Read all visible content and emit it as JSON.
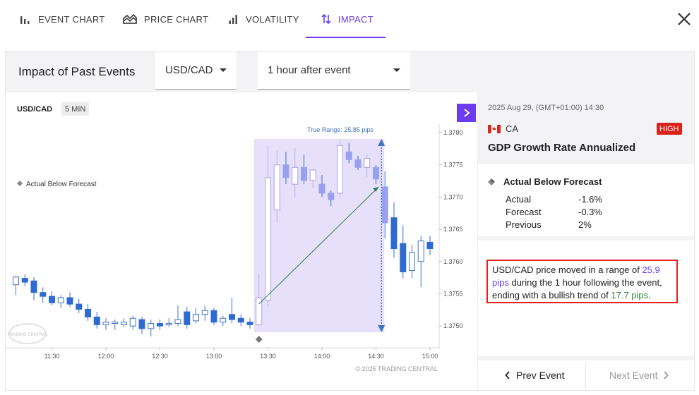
{
  "tabs": [
    {
      "label": "EVENT CHART",
      "icon": "bar-chart-icon"
    },
    {
      "label": "PRICE CHART",
      "icon": "price-chart-icon"
    },
    {
      "label": "VOLATILITY",
      "icon": "volatility-icon"
    },
    {
      "label": "IMPACT",
      "icon": "up-down-arrows-icon",
      "active": true
    }
  ],
  "panel": {
    "title": "Impact of Past Events",
    "pair_select": "USD/CAD",
    "window_select": "1 hour after event"
  },
  "chart": {
    "symbol": "USD/CAD",
    "timeframe": "5 MIN",
    "legend_marker": "Actual Below Forecast",
    "range_label": "True Range: 25.85 pips",
    "watermark": "TRADING CENTRAL",
    "copyright": "© 2025 TRADING CENTRAL"
  },
  "chart_data": {
    "type": "candlestick",
    "instrument": "USD/CAD",
    "interval": "5 MIN",
    "x_ticks": [
      "11:30",
      "12:00",
      "12:30",
      "13:00",
      "13:30",
      "14:00",
      "14:30",
      "15:00"
    ],
    "y_ticks": [
      1.378,
      1.3775,
      1.377,
      1.3765,
      1.376,
      1.3755,
      1.375
    ],
    "ylim": [
      1.3748,
      1.3782
    ],
    "event_time": "13:30",
    "window": [
      "13:30",
      "14:30"
    ],
    "candles": [
      {
        "t": 0,
        "o": 1.37564,
        "h": 1.37578,
        "l": 1.37548,
        "c": 1.37576
      },
      {
        "t": 1,
        "o": 1.37574,
        "h": 1.3758,
        "l": 1.37562,
        "c": 1.37568
      },
      {
        "t": 2,
        "o": 1.3757,
        "h": 1.37576,
        "l": 1.3754,
        "c": 1.37552
      },
      {
        "t": 3,
        "o": 1.37552,
        "h": 1.3756,
        "l": 1.37536,
        "c": 1.37546
      },
      {
        "t": 4,
        "o": 1.37546,
        "h": 1.37554,
        "l": 1.37532,
        "c": 1.37536
      },
      {
        "t": 5,
        "o": 1.37536,
        "h": 1.37548,
        "l": 1.37528,
        "c": 1.37544
      },
      {
        "t": 6,
        "o": 1.37544,
        "h": 1.37552,
        "l": 1.3753,
        "c": 1.37534
      },
      {
        "t": 7,
        "o": 1.37534,
        "h": 1.37542,
        "l": 1.3752,
        "c": 1.37526
      },
      {
        "t": 8,
        "o": 1.37526,
        "h": 1.37534,
        "l": 1.37508,
        "c": 1.37514
      },
      {
        "t": 9,
        "o": 1.37514,
        "h": 1.37522,
        "l": 1.37496,
        "c": 1.37502
      },
      {
        "t": 10,
        "o": 1.37502,
        "h": 1.37512,
        "l": 1.37494,
        "c": 1.37506
      },
      {
        "t": 11,
        "o": 1.37504,
        "h": 1.3751,
        "l": 1.37494,
        "c": 1.37506
      },
      {
        "t": 12,
        "o": 1.37502,
        "h": 1.37512,
        "l": 1.37498,
        "c": 1.37506
      },
      {
        "t": 13,
        "o": 1.375,
        "h": 1.37516,
        "l": 1.37494,
        "c": 1.37512
      },
      {
        "t": 14,
        "o": 1.3751,
        "h": 1.37514,
        "l": 1.37488,
        "c": 1.37496
      },
      {
        "t": 15,
        "o": 1.37496,
        "h": 1.3751,
        "l": 1.37484,
        "c": 1.37504
      },
      {
        "t": 16,
        "o": 1.37504,
        "h": 1.3751,
        "l": 1.37494,
        "c": 1.375
      },
      {
        "t": 17,
        "o": 1.37502,
        "h": 1.37512,
        "l": 1.37498,
        "c": 1.37504
      },
      {
        "t": 18,
        "o": 1.37504,
        "h": 1.37532,
        "l": 1.375,
        "c": 1.3751
      },
      {
        "t": 19,
        "o": 1.37522,
        "h": 1.3753,
        "l": 1.37496,
        "c": 1.37502
      },
      {
        "t": 20,
        "o": 1.37508,
        "h": 1.37528,
        "l": 1.37504,
        "c": 1.37518
      },
      {
        "t": 21,
        "o": 1.37518,
        "h": 1.37532,
        "l": 1.37508,
        "c": 1.37524
      },
      {
        "t": 22,
        "o": 1.37524,
        "h": 1.37528,
        "l": 1.37502,
        "c": 1.37506
      },
      {
        "t": 23,
        "o": 1.37506,
        "h": 1.37516,
        "l": 1.375,
        "c": 1.37512
      },
      {
        "t": 24,
        "o": 1.37518,
        "h": 1.37544,
        "l": 1.37504,
        "c": 1.3751
      },
      {
        "t": 25,
        "o": 1.37512,
        "h": 1.37518,
        "l": 1.375,
        "c": 1.37506
      },
      {
        "t": 26,
        "o": 1.37506,
        "h": 1.37512,
        "l": 1.37496,
        "c": 1.37502
      },
      {
        "t": 27,
        "o": 1.37502,
        "h": 1.3758,
        "l": 1.375,
        "c": 1.37544
      },
      {
        "t": 28,
        "o": 1.3754,
        "h": 1.3778,
        "l": 1.3753,
        "c": 1.3773
      },
      {
        "t": 29,
        "o": 1.3768,
        "h": 1.37772,
        "l": 1.3766,
        "c": 1.3775
      },
      {
        "t": 30,
        "o": 1.3775,
        "h": 1.3777,
        "l": 1.3772,
        "c": 1.3773
      },
      {
        "t": 31,
        "o": 1.3772,
        "h": 1.37776,
        "l": 1.377,
        "c": 1.37746
      },
      {
        "t": 32,
        "o": 1.37746,
        "h": 1.37766,
        "l": 1.3772,
        "c": 1.37726
      },
      {
        "t": 33,
        "o": 1.37726,
        "h": 1.37744,
        "l": 1.37714,
        "c": 1.37742
      },
      {
        "t": 34,
        "o": 1.3772,
        "h": 1.37734,
        "l": 1.377,
        "c": 1.37706
      },
      {
        "t": 35,
        "o": 1.37706,
        "h": 1.3771,
        "l": 1.37686,
        "c": 1.37696
      },
      {
        "t": 36,
        "o": 1.37706,
        "h": 1.3779,
        "l": 1.377,
        "c": 1.3778
      },
      {
        "t": 37,
        "o": 1.3777,
        "h": 1.37784,
        "l": 1.37752,
        "c": 1.37758
      },
      {
        "t": 38,
        "o": 1.37758,
        "h": 1.37764,
        "l": 1.37742,
        "c": 1.37746
      },
      {
        "t": 39,
        "o": 1.37746,
        "h": 1.37766,
        "l": 1.3773,
        "c": 1.3776
      },
      {
        "t": 40,
        "o": 1.37746,
        "h": 1.3775,
        "l": 1.3772,
        "c": 1.37728
      },
      {
        "t": 41,
        "o": 1.37716,
        "h": 1.3774,
        "l": 1.37636,
        "c": 1.3766
      },
      {
        "t": 42,
        "o": 1.37668,
        "h": 1.37692,
        "l": 1.37606,
        "c": 1.3762
      },
      {
        "t": 43,
        "o": 1.37628,
        "h": 1.37656,
        "l": 1.37574,
        "c": 1.37584
      },
      {
        "t": 44,
        "o": 1.37586,
        "h": 1.37626,
        "l": 1.37574,
        "c": 1.37614
      },
      {
        "t": 45,
        "o": 1.376,
        "h": 1.3764,
        "l": 1.3756,
        "c": 1.37632
      },
      {
        "t": 46,
        "o": 1.3763,
        "h": 1.3764,
        "l": 1.3761,
        "c": 1.3762
      }
    ],
    "true_range_pips": 25.85,
    "trend_pips": 17.7
  },
  "event": {
    "datetime": "2025 Aug 29, (GMT+01:00) 14:30",
    "country": "CA",
    "importance": "HIGH",
    "title": "GDP Growth Rate Annualized",
    "outcome": "Actual Below Forecast",
    "stats": [
      {
        "label": "Actual",
        "value": "-1.6%"
      },
      {
        "label": "Forecast",
        "value": "-0.3%"
      },
      {
        "label": "Previous",
        "value": "2%"
      }
    ],
    "summary": {
      "p1": "USD/CAD price moved in a range of ",
      "range": "25.9 pips",
      "p2": " during the 1 hour following the event, ending with a bullish trend of ",
      "trend": "17.7 pips",
      "p3": "."
    }
  },
  "nav": {
    "prev": "Prev Event",
    "next": "Next Event"
  },
  "colors": {
    "accent": "#6c3bf0",
    "bull": "#3f73c9",
    "bear": "#2f6ad0",
    "window": "#e6e0fb",
    "trend": "#2d7a4a",
    "high": "#d9221c",
    "summary_border": "#e2231a"
  }
}
